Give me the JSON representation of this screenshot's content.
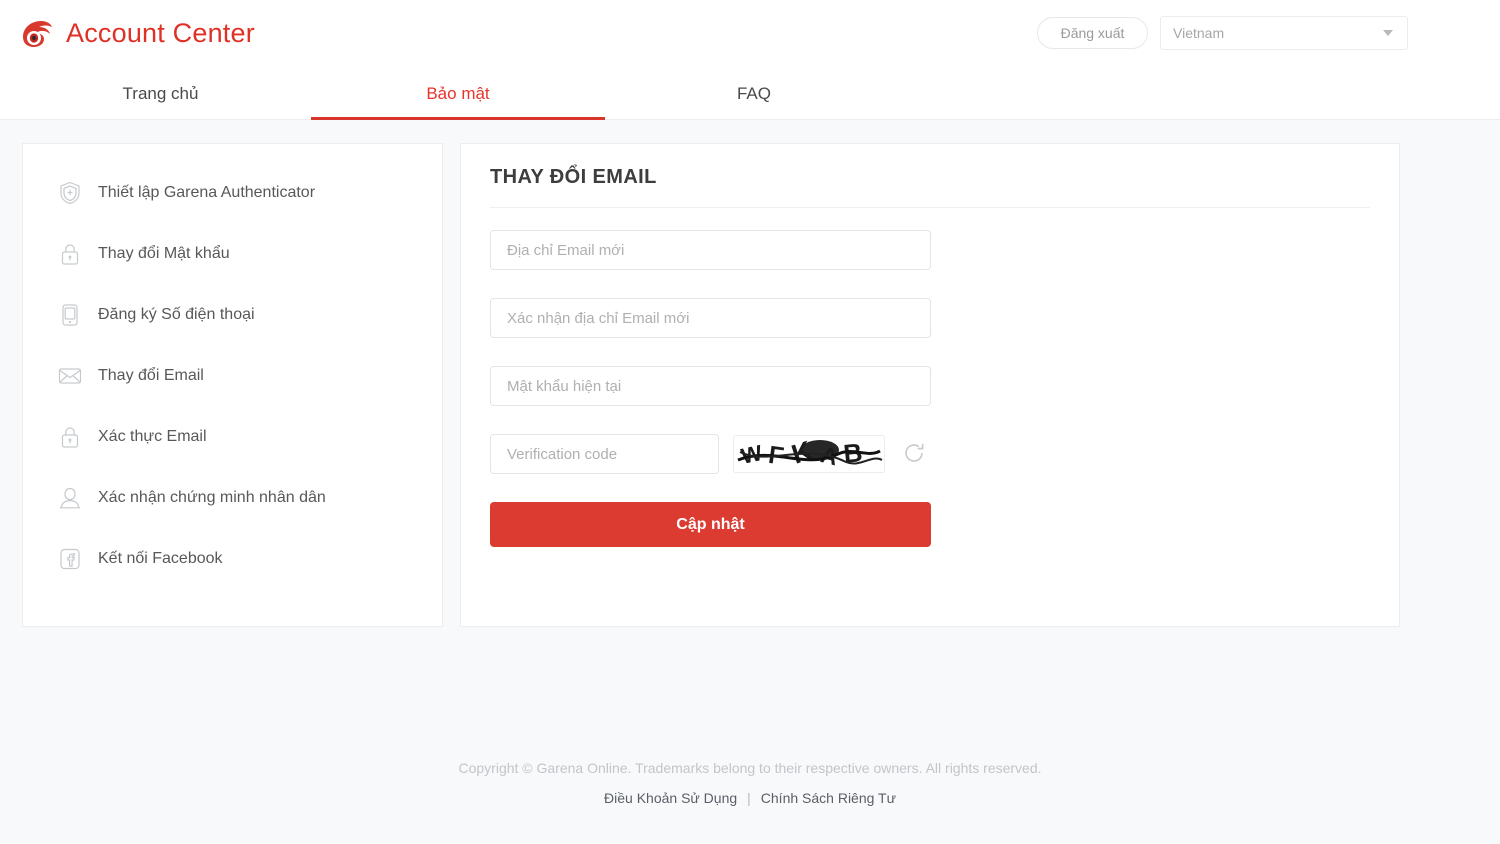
{
  "header": {
    "brand_title": "Account Center",
    "logo_icon": "garena-eye-logo",
    "logout_label": "Đăng xuất",
    "language_value": "Vietnam",
    "language_caret_icon": "chevron-down-icon"
  },
  "nav": {
    "tabs": [
      {
        "label": "Trang chủ",
        "active": false
      },
      {
        "label": "Bảo mật",
        "active": true
      },
      {
        "label": "FAQ",
        "active": false
      }
    ]
  },
  "sidebar": {
    "items": [
      {
        "label": "Thiết lập Garena Authenticator",
        "icon": "shield-check-icon"
      },
      {
        "label": "Thay đổi Mật khẩu",
        "icon": "lock-icon"
      },
      {
        "label": "Đăng ký Số điện thoại",
        "icon": "mobile-phone-icon"
      },
      {
        "label": "Thay đổi Email",
        "icon": "envelope-icon"
      },
      {
        "label": "Xác thực Email",
        "icon": "lock-icon"
      },
      {
        "label": "Xác nhận chứng minh nhân dân",
        "icon": "user-icon"
      },
      {
        "label": "Kết nối Facebook",
        "icon": "facebook-icon"
      }
    ]
  },
  "main": {
    "title": "THAY ĐỔI EMAIL",
    "fields": {
      "new_email_placeholder": "Địa chỉ Email mới",
      "new_email_value": "",
      "confirm_email_placeholder": "Xác nhận địa chỉ Email mới",
      "confirm_email_value": "",
      "current_password_placeholder": "Mật khẩu hiện tại",
      "current_password_value": "",
      "verification_code_placeholder": "Verification code",
      "verification_code_value": ""
    },
    "captcha": {
      "text": "WFKAB",
      "image_name": "captcha-image",
      "refresh_icon": "refresh-icon"
    },
    "submit_label": "Cập nhật"
  },
  "footer": {
    "copyright": "Copyright © Garena Online. Trademarks belong to their respective owners. All rights reserved.",
    "terms_label": "Điều Khoản Sử Dụng",
    "separator": "|",
    "privacy_label": "Chính Sách Riêng Tư"
  },
  "colors": {
    "brand_red": "#e03127",
    "accent_red": "#db3b31",
    "page_bg": "#f8f9fb",
    "panel_bg": "#ffffff",
    "border": "#ededed"
  }
}
